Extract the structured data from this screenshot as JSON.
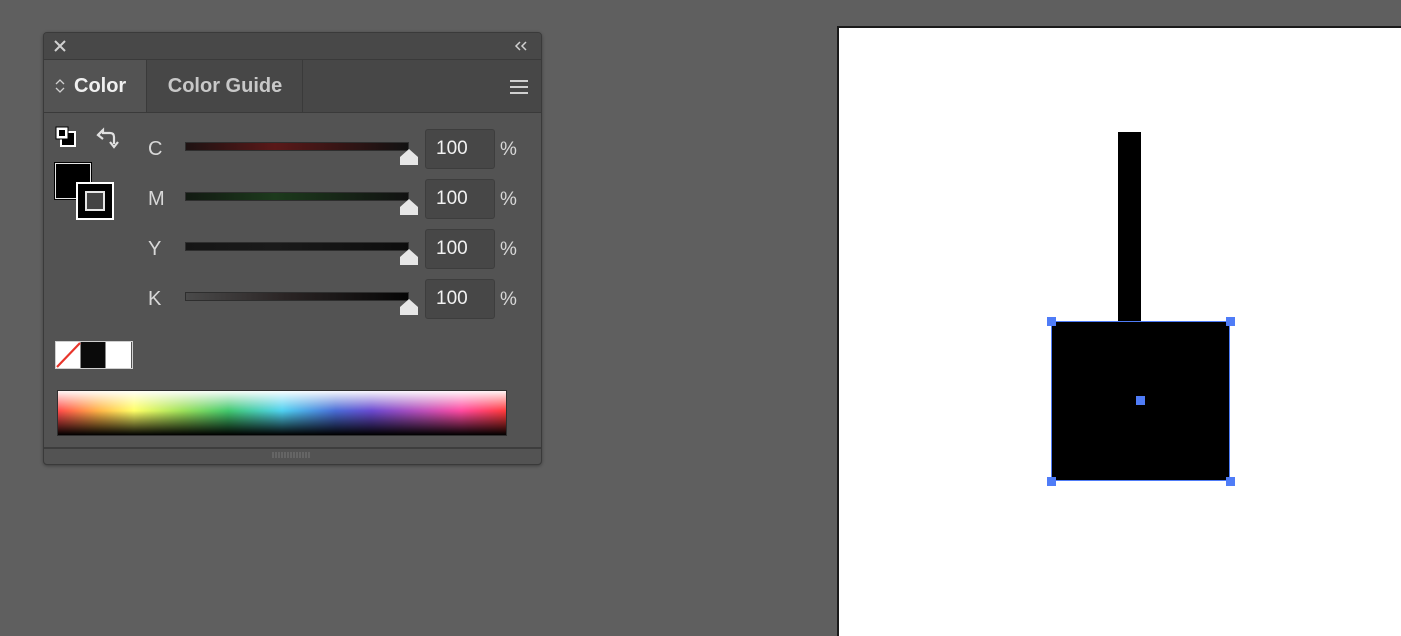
{
  "panel": {
    "tabs": [
      {
        "label": "Color",
        "active": true
      },
      {
        "label": "Color Guide",
        "active": false
      }
    ],
    "sliders": [
      {
        "label": "C",
        "value": "100",
        "unit": "%",
        "level": 1.0,
        "track_color": "#6a1a1a"
      },
      {
        "label": "M",
        "value": "100",
        "unit": "%",
        "level": 1.0,
        "track_color": "#1a4a1a"
      },
      {
        "label": "Y",
        "value": "100",
        "unit": "%",
        "level": 1.0,
        "track_color": "#222222"
      },
      {
        "label": "K",
        "value": "100",
        "unit": "%",
        "level": 1.0,
        "track_color": "#555555"
      }
    ],
    "fill_color": "#000000",
    "stroke_color": "#000000",
    "swatches": [
      "none",
      "black",
      "white"
    ],
    "icons": {
      "close": "close-icon",
      "collapse": "collapse-icon",
      "menu": "menu-icon",
      "swap": "swap-fill-stroke-icon",
      "default": "default-fill-stroke-icon",
      "tab_toggle": "updown-icon"
    }
  },
  "canvas": {
    "background": "#ffffff",
    "selection_color": "#4f7cf7",
    "shape_color": "#000000"
  }
}
